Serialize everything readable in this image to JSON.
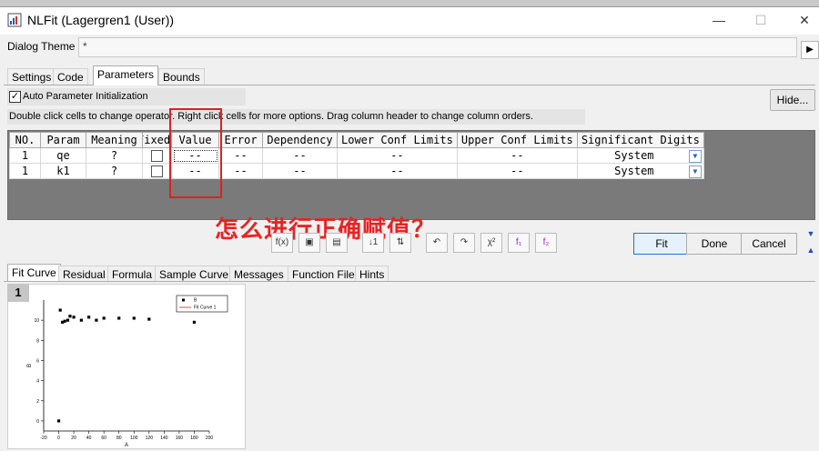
{
  "window": {
    "title": "NLFit (Lagergren1 (User))",
    "minimize_glyph": "—",
    "maximize_glyph": "☐",
    "close_glyph": "✕"
  },
  "theme": {
    "label": "Dialog Theme",
    "value": "*"
  },
  "tabs": [
    "Settings",
    "Code",
    "Parameters",
    "Bounds"
  ],
  "active_tab": "Parameters",
  "auto_init": {
    "label": "Auto Parameter Initialization",
    "checked": true
  },
  "hide_button": "Hide...",
  "hint": "Double click cells to change operator. Right click cells for more options. Drag column header to change column orders.",
  "table": {
    "headers": [
      "NO.",
      "Param",
      "Meaning",
      "Fixed",
      "Value",
      "Error",
      "Dependency",
      "Lower Conf Limits",
      "Upper Conf Limits",
      "Significant Digits"
    ],
    "rows": [
      [
        "1",
        "qe",
        "?",
        "",
        "--",
        "--",
        "--",
        "--",
        "--",
        "System"
      ],
      [
        "1",
        "k1",
        "?",
        "",
        "--",
        "--",
        "--",
        "--",
        "--",
        "System"
      ]
    ]
  },
  "question": "怎么进行正确赋值？",
  "toolbar": [
    "f(x)",
    "▣",
    "▤",
    "↓1",
    "⇅",
    "↶",
    "↷",
    "χ²",
    "f₁",
    "f₂"
  ],
  "dialog_buttons": {
    "fit": "Fit",
    "done": "Done",
    "cancel": "Cancel"
  },
  "bottom_tabs": [
    "Fit Curve",
    "Residual",
    "Formula",
    "Sample Curve",
    "Messages",
    "Function File",
    "Hints"
  ],
  "active_bottom_tab": "Fit Curve",
  "page_number": "1",
  "chart_data": {
    "type": "scatter",
    "series": [
      {
        "name": "B",
        "x": [
          0,
          2,
          5,
          8,
          12,
          15,
          20,
          30,
          40,
          50,
          60,
          80,
          100,
          120,
          180
        ],
        "y": [
          0,
          11,
          9.8,
          9.9,
          10,
          10.4,
          10.3,
          10,
          10.3,
          10,
          10.2,
          10.2,
          10.2,
          10.1,
          9.8
        ]
      },
      {
        "name": "Fit Curve 1",
        "x": [],
        "y": []
      }
    ],
    "xlabel": "A",
    "ylabel": "B",
    "xlim": [
      -20,
      200
    ],
    "ylim": [
      -1,
      12
    ],
    "xticks": [
      "-20",
      "0",
      "20",
      "40",
      "60",
      "80",
      "100",
      "120",
      "140",
      "160",
      "180",
      "200"
    ],
    "yticks": [
      "0",
      "2",
      "4",
      "6",
      "8",
      "10"
    ],
    "legend": "top-right",
    "colors": {
      "points": "#000000",
      "fit": "#e02020"
    }
  }
}
